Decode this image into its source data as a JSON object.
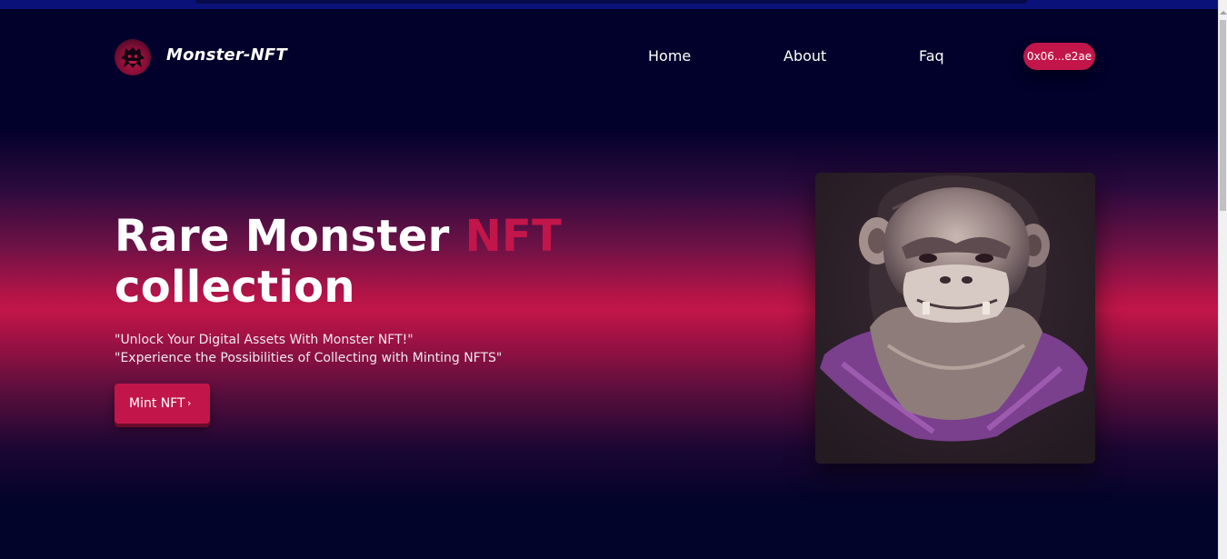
{
  "nav": {
    "brand": "Monster-NFT",
    "links": [
      "Home",
      "About",
      "Faq"
    ],
    "wallet": "0x06...e2ae"
  },
  "hero": {
    "title_part1": "Rare Monster ",
    "title_accent": "NFT",
    "title_part2": "collection",
    "tagline_line1": "\"Unlock Your Digital Assets With Monster NFT!\"",
    "tagline_line2": "\"Experience the Possibilities of Collecting with Minting NFTS\"",
    "mint_label": "Mint NFT",
    "mint_chevron": "›"
  },
  "colors": {
    "accent": "#c2164a",
    "background": "#01012b"
  },
  "icons": {
    "logo": "monster-logo-icon",
    "nft_image": "ape-monster-artwork"
  }
}
